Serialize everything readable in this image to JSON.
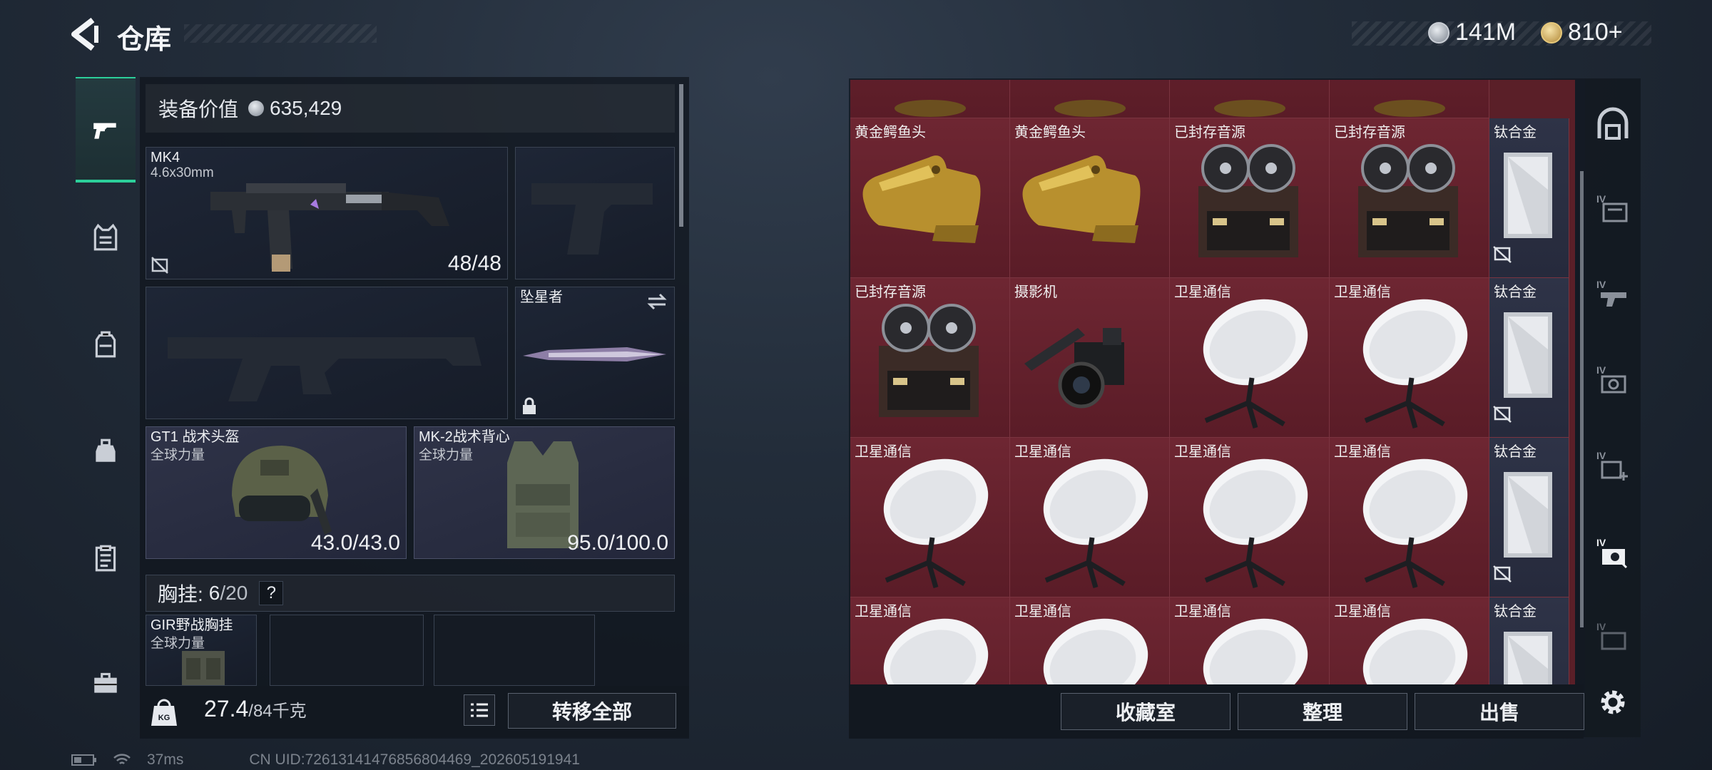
{
  "header": {
    "title": "仓库"
  },
  "currency": [
    {
      "icon": "silver-coin-icon",
      "value": "141M"
    },
    {
      "icon": "gold-coin-icon",
      "value": "810+"
    }
  ],
  "left_tabs": [
    {
      "name": "weapons-tab-icon",
      "active": true
    },
    {
      "name": "armor-tab-icon"
    },
    {
      "name": "backpack-tab-icon"
    },
    {
      "name": "pouch-tab-icon"
    },
    {
      "name": "clipboard-tab-icon"
    },
    {
      "name": "toolbox-tab-icon"
    }
  ],
  "equipment": {
    "value_label": "装备价值",
    "value": "635,429",
    "primary_weapon": {
      "name": "MK4",
      "caliber": "4.6x30mm",
      "ammo": "48/48"
    },
    "melee": {
      "name": "坠星者"
    },
    "helmet": {
      "name": "GT1 战术头盔",
      "faction": "全球力量",
      "durability": "43.0/43.0"
    },
    "vest": {
      "name": "MK-2战术背心",
      "faction": "全球力量",
      "durability": "95.0/100.0"
    },
    "chest_rig": {
      "label": "胸挂:",
      "used": "6",
      "total": "/20",
      "help": "?"
    },
    "chest_item": {
      "name": "GIR野战胸挂",
      "faction": "全球力量"
    }
  },
  "weight": {
    "current": "27.4",
    "max": "/84千克"
  },
  "buttons": {
    "transfer_all": "转移全部",
    "collection": "收藏室",
    "organize": "整理",
    "sell": "出售"
  },
  "stash_rows": [
    [
      "黄金鳄鱼头",
      "黄金鳄鱼头",
      "已封存音源",
      "已封存音源",
      "钛合金"
    ],
    [
      "已封存音源",
      "摄影机",
      "卫星通信",
      "卫星通信",
      "钛合金"
    ],
    [
      "卫星通信",
      "卫星通信",
      "卫星通信",
      "卫星通信",
      "钛合金"
    ],
    [
      "卫星通信",
      "卫星通信",
      "卫星通信",
      "卫星通信",
      "钛合金"
    ]
  ],
  "status": {
    "ping": "37ms",
    "uid": "CN UID:72613141476856804469_202605191941"
  },
  "colors": {
    "accent": "#2ccf9a",
    "stash_red": "#6e2632",
    "titanium_blue": "#2e3347"
  }
}
